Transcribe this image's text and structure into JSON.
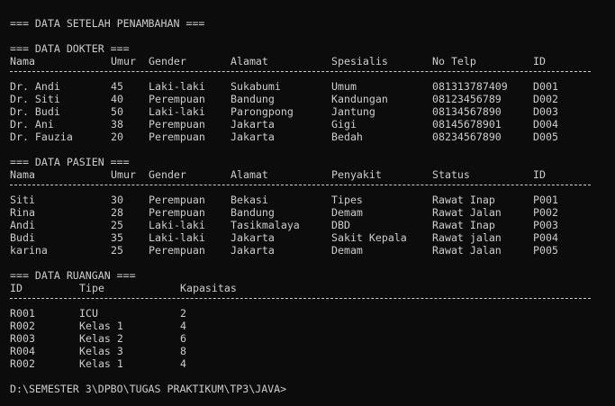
{
  "terminal": {
    "header": "=== DATA SETELAH PENAMBAHAN ===",
    "prompt": "D:\\SEMESTER 3\\DPBO\\TUGAS PRAKTIKUM\\TP3\\JAVA>"
  },
  "dokter": {
    "title": "=== DATA DOKTER ===",
    "columns": [
      "Nama",
      "Umur",
      "Gender",
      "Alamat",
      "Spesialis",
      "No Telp",
      "ID"
    ],
    "rows": [
      [
        "Dr. Andi",
        "45",
        "Laki-laki",
        "Sukabumi",
        "Umum",
        "081313787409",
        "D001"
      ],
      [
        "Dr. Siti",
        "40",
        "Perempuan",
        "Bandung",
        "Kandungan",
        "08123456789",
        "D002"
      ],
      [
        "Dr. Budi",
        "50",
        "Laki-laki",
        "Parongpong",
        "Jantung",
        "08134567890",
        "D003"
      ],
      [
        "Dr. Ani",
        "38",
        "Perempuan",
        "Jakarta",
        "Gigi",
        "08145678901",
        "D004"
      ],
      [
        "Dr. Fauzia",
        "20",
        "Perempuan",
        "Jakarta",
        "Bedah",
        "08234567890",
        "D005"
      ]
    ]
  },
  "pasien": {
    "title": "=== DATA PASIEN ===",
    "columns": [
      "Nama",
      "Umur",
      "Gender",
      "Alamat",
      "Penyakit",
      "Status",
      "ID"
    ],
    "rows": [
      [
        "Siti",
        "30",
        "Perempuan",
        "Bekasi",
        "Tipes",
        "Rawat Inap",
        "P001"
      ],
      [
        "Rina",
        "28",
        "Perempuan",
        "Bandung",
        "Demam",
        "Rawat Jalan",
        "P002"
      ],
      [
        "Andi",
        "25",
        "Laki-laki",
        "Tasikmalaya",
        "DBD",
        "Rawat Inap",
        "P003"
      ],
      [
        "Budi",
        "35",
        "Laki-laki",
        "Jakarta",
        "Sakit Kepala",
        "Rawat jalan",
        "P004"
      ],
      [
        "karina",
        "25",
        "Perempuan",
        "Jakarta",
        "Demam",
        "Rawat Jalan",
        "P005"
      ]
    ]
  },
  "ruangan": {
    "title": "=== DATA RUANGAN ===",
    "columns": [
      "ID",
      "Tipe",
      "Kapasitas"
    ],
    "rows": [
      [
        "R001",
        "ICU",
        "2"
      ],
      [
        "R002",
        "Kelas 1",
        "4"
      ],
      [
        "R003",
        "Kelas 2",
        "6"
      ],
      [
        "R004",
        "Kelas 3",
        "8"
      ],
      [
        "R002",
        "Kelas 1",
        "4"
      ]
    ]
  }
}
